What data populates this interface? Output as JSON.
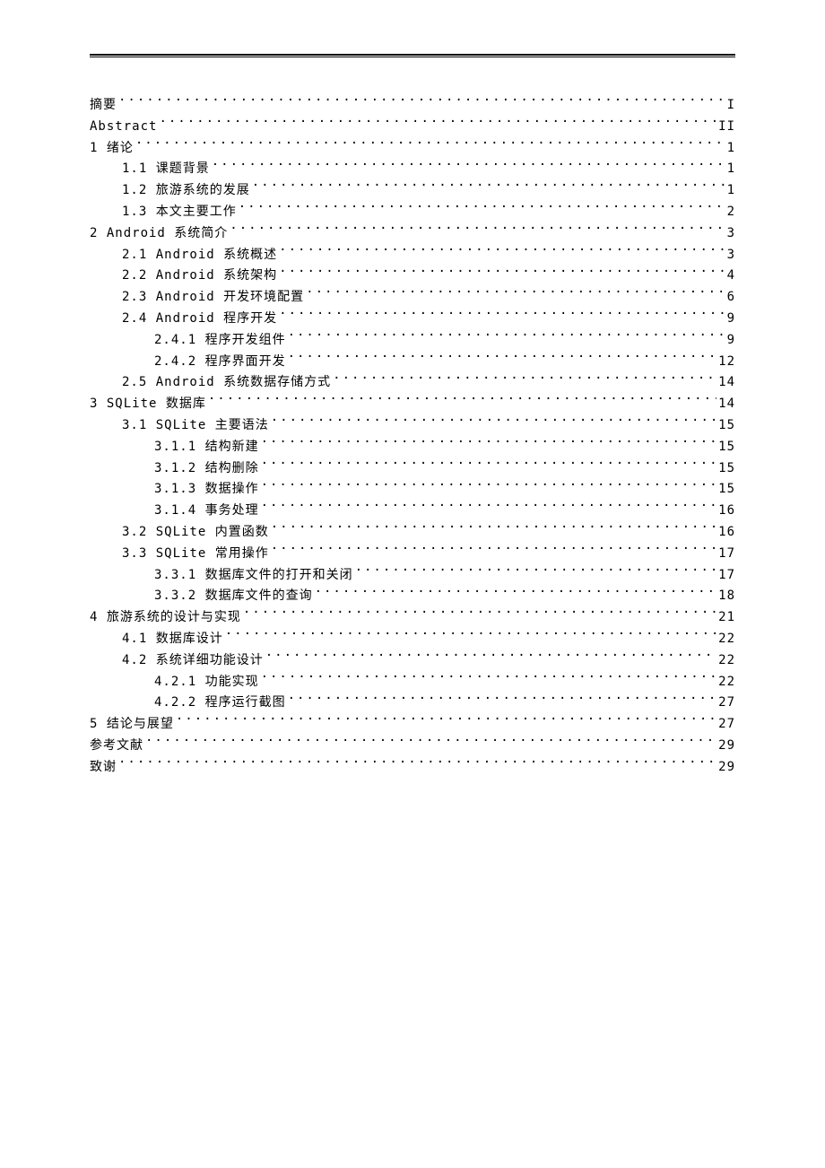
{
  "toc": [
    {
      "level": 0,
      "title": "摘要",
      "page": "I"
    },
    {
      "level": 0,
      "title": "Abstract",
      "page": "II"
    },
    {
      "level": 0,
      "title": "1 绪论",
      "page": "1"
    },
    {
      "level": 1,
      "title": "1.1 课题背景",
      "page": "1"
    },
    {
      "level": 1,
      "title": "1.2 旅游系统的发展",
      "page": "1"
    },
    {
      "level": 1,
      "title": "1.3 本文主要工作",
      "page": "2"
    },
    {
      "level": 0,
      "title": "2 Android 系统简介",
      "page": "3"
    },
    {
      "level": 1,
      "title": "2.1 Android 系统概述",
      "page": "3"
    },
    {
      "level": 1,
      "title": "2.2 Android 系统架构",
      "page": "4"
    },
    {
      "level": 1,
      "title": "2.3 Android 开发环境配置",
      "page": "6"
    },
    {
      "level": 1,
      "title": "2.4 Android 程序开发",
      "page": "9"
    },
    {
      "level": 2,
      "title": "2.4.1 程序开发组件",
      "page": "9"
    },
    {
      "level": 2,
      "title": "2.4.2 程序界面开发",
      "page": "12"
    },
    {
      "level": 1,
      "title": "2.5 Android 系统数据存储方式",
      "page": "14"
    },
    {
      "level": 0,
      "title": "3 SQLite 数据库",
      "page": "14"
    },
    {
      "level": 1,
      "title": "3.1 SQLite 主要语法",
      "page": "15"
    },
    {
      "level": 2,
      "title": "3.1.1 结构新建",
      "page": "15"
    },
    {
      "level": 2,
      "title": "3.1.2 结构删除",
      "page": "15"
    },
    {
      "level": 2,
      "title": "3.1.3 数据操作",
      "page": "15"
    },
    {
      "level": 2,
      "title": "3.1.4 事务处理",
      "page": "16"
    },
    {
      "level": 1,
      "title": "3.2 SQLite 内置函数",
      "page": "16"
    },
    {
      "level": 1,
      "title": "3.3 SQLite 常用操作",
      "page": "17"
    },
    {
      "level": 2,
      "title": "3.3.1 数据库文件的打开和关闭",
      "page": "17"
    },
    {
      "level": 2,
      "title": "3.3.2 数据库文件的查询",
      "page": "18"
    },
    {
      "level": 0,
      "title": "4 旅游系统的设计与实现",
      "page": "21"
    },
    {
      "level": 1,
      "title": "4.1 数据库设计",
      "page": "22"
    },
    {
      "level": 1,
      "title": "4.2 系统详细功能设计",
      "page": "22"
    },
    {
      "level": 2,
      "title": "4.2.1 功能实现",
      "page": "22"
    },
    {
      "level": 2,
      "title": "4.2.2 程序运行截图",
      "page": "27"
    },
    {
      "level": 0,
      "title": "5 结论与展望",
      "page": "27"
    },
    {
      "level": 0,
      "title": "参考文献",
      "page": "29"
    },
    {
      "level": 0,
      "title": "致谢",
      "page": "29"
    }
  ]
}
